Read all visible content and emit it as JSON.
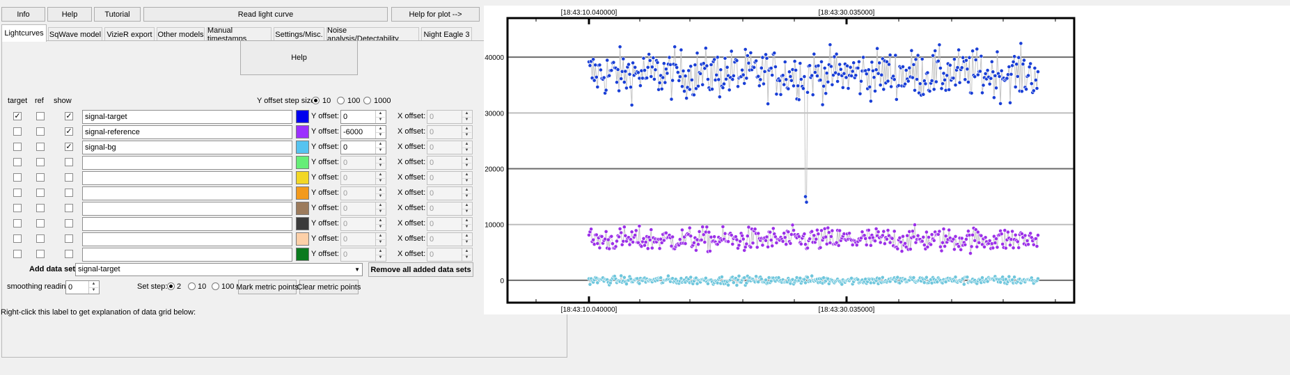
{
  "toolbar": {
    "info": "Info",
    "help": "Help",
    "tutorial": "Tutorial",
    "read_light_curve": "Read light curve",
    "help_for_plot": "Help for plot -->"
  },
  "tabs": [
    "Lightcurves",
    "SqWave model",
    "VizieR export",
    "Other models",
    "Manual timestamps",
    "Settings/Misc.",
    "Noise analysis/Detectability",
    "Night Eagle 3"
  ],
  "active_tab": "Lightcurves",
  "panel": {
    "help_button": "Help",
    "col_target": "target",
    "col_ref": "ref",
    "col_show": "show",
    "y_step_label": "Y offset step size:",
    "y_step_options": [
      "10",
      "100",
      "1000"
    ],
    "y_step_selected": "10",
    "y_offset_label": "Y offset:",
    "x_offset_label": "X offset:",
    "check_mark": "✓",
    "rows": [
      {
        "target": true,
        "ref": false,
        "show": true,
        "name": "signal-target",
        "color": "#0000ee",
        "y_offset": "0",
        "x_offset": "0",
        "enabled": true
      },
      {
        "target": false,
        "ref": false,
        "show": true,
        "name": "signal-reference",
        "color": "#9b30ff",
        "y_offset": "-6000",
        "x_offset": "0",
        "enabled": true
      },
      {
        "target": false,
        "ref": false,
        "show": true,
        "name": "signal-bg",
        "color": "#56c3f0",
        "y_offset": "0",
        "x_offset": "0",
        "enabled": true
      },
      {
        "target": false,
        "ref": false,
        "show": false,
        "name": "",
        "color": "#66ee77",
        "y_offset": "0",
        "x_offset": "0",
        "enabled": false
      },
      {
        "target": false,
        "ref": false,
        "show": false,
        "name": "",
        "color": "#f2d726",
        "y_offset": "0",
        "x_offset": "0",
        "enabled": false
      },
      {
        "target": false,
        "ref": false,
        "show": false,
        "name": "",
        "color": "#f39a1c",
        "y_offset": "0",
        "x_offset": "0",
        "enabled": false
      },
      {
        "target": false,
        "ref": false,
        "show": false,
        "name": "",
        "color": "#9c7b5c",
        "y_offset": "0",
        "x_offset": "0",
        "enabled": false
      },
      {
        "target": false,
        "ref": false,
        "show": false,
        "name": "",
        "color": "#3b3b3b",
        "y_offset": "0",
        "x_offset": "0",
        "enabled": false
      },
      {
        "target": false,
        "ref": false,
        "show": false,
        "name": "",
        "color": "#fdd0a8",
        "y_offset": "0",
        "x_offset": "0",
        "enabled": false
      },
      {
        "target": false,
        "ref": false,
        "show": false,
        "name": "",
        "color": "#0a7a1e",
        "y_offset": "0",
        "x_offset": "0",
        "enabled": false
      }
    ],
    "add_data_set_label": "Add data set",
    "add_data_set_value": "signal-target",
    "remove_all": "Remove all added data sets",
    "smoothing_label": "smoothing readings",
    "smoothing_value": "0",
    "set_step_label": "Set step:",
    "set_step_options": [
      "2",
      "10",
      "100"
    ],
    "set_step_selected": "2",
    "mark_metric": "Mark metric points",
    "clear_metric": "Clear metric points"
  },
  "status_text": "Right-click this label to get explanation of data grid below:",
  "chart_data": {
    "type": "scatter",
    "top_tick_labels": [
      "[18:43:10.040000]",
      "[18:43:30.035000]"
    ],
    "bottom_tick_labels": [
      "[18:43:10.040000]",
      "[18:43:30.035000]"
    ],
    "y_ticks": [
      0,
      10000,
      20000,
      30000,
      40000
    ],
    "ylim": [
      -4000,
      47000
    ],
    "grid": true,
    "series": [
      {
        "color": "#1a3fd6",
        "mean": 37000,
        "spread": 3000,
        "min": 28500,
        "max": 47000,
        "outlier": {
          "y": [
            15000,
            14000
          ]
        }
      },
      {
        "color": "#9b30e8",
        "mean": 7300,
        "spread": 1500,
        "min": 3500,
        "max": 13800
      },
      {
        "color": "#6ec6dc",
        "mean": 0,
        "spread": 500,
        "min": -2000,
        "max": 2500
      }
    ]
  }
}
